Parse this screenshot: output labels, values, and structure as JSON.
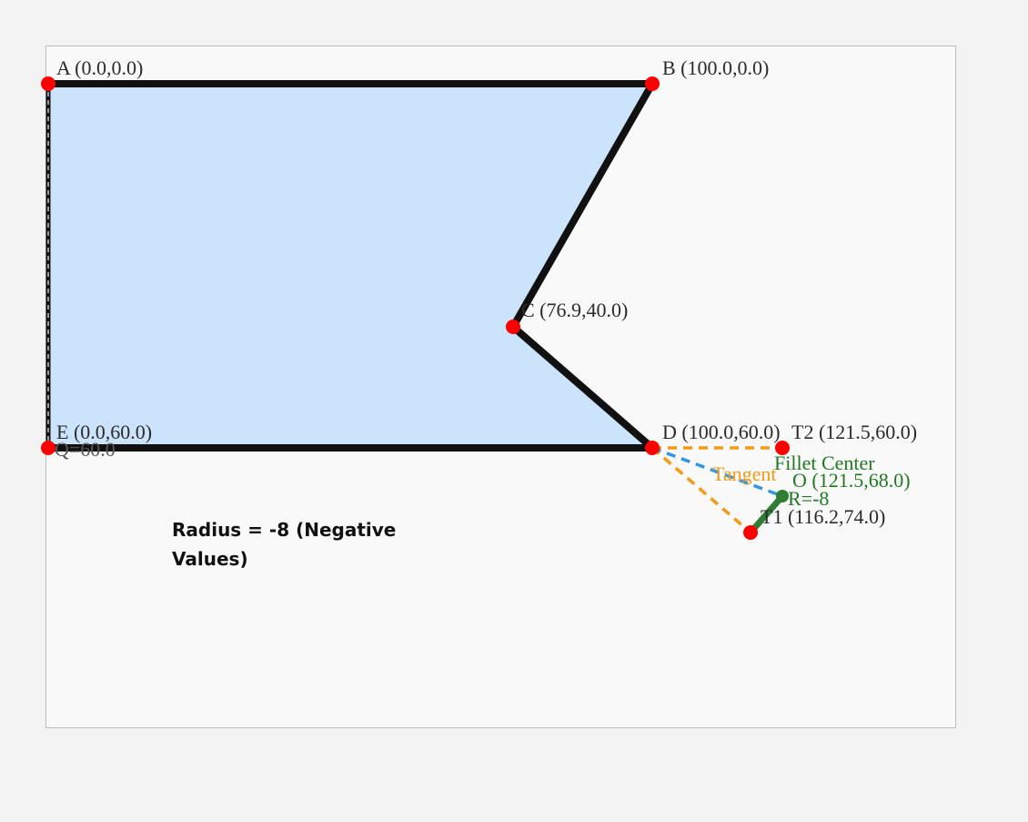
{
  "points": {
    "A": {
      "label": "A (0.0,0.0)",
      "x": 0.0,
      "y": 0.0
    },
    "B": {
      "label": "B (100.0,0.0)",
      "x": 100.0,
      "y": 0.0
    },
    "C": {
      "label": "C (76.9,40.0)",
      "x": 76.9,
      "y": 40.0
    },
    "D": {
      "label": "D (100.0,60.0)",
      "x": 100.0,
      "y": 60.0
    },
    "E": {
      "label": "E (0.0,60.0)",
      "x": 0.0,
      "y": 60.0
    },
    "T1": {
      "label": "T1 (116.2,74.0)",
      "x": 116.2,
      "y": 74.0
    },
    "T2": {
      "label": "T2 (121.5,60.0)",
      "x": 121.5,
      "y": 60.0
    },
    "O": {
      "label": "O (121.5,68.0)",
      "x": 121.5,
      "y": 68.0
    }
  },
  "annotations": {
    "fillet_center": "Fillet Center",
    "tangent": "Tangent",
    "radius_label": "R=-8",
    "edge_label": "Q=60.0"
  },
  "note": "Radius =  -8 (Negative Values)",
  "colors": {
    "fill": "#cce3fc",
    "outline": "#111111",
    "point": "#ff0000",
    "tangent_line": "#f59a12",
    "center_line": "#2f96e8",
    "radius_line": "#2e7d32",
    "edge_dashed": "#9a9a9a"
  }
}
